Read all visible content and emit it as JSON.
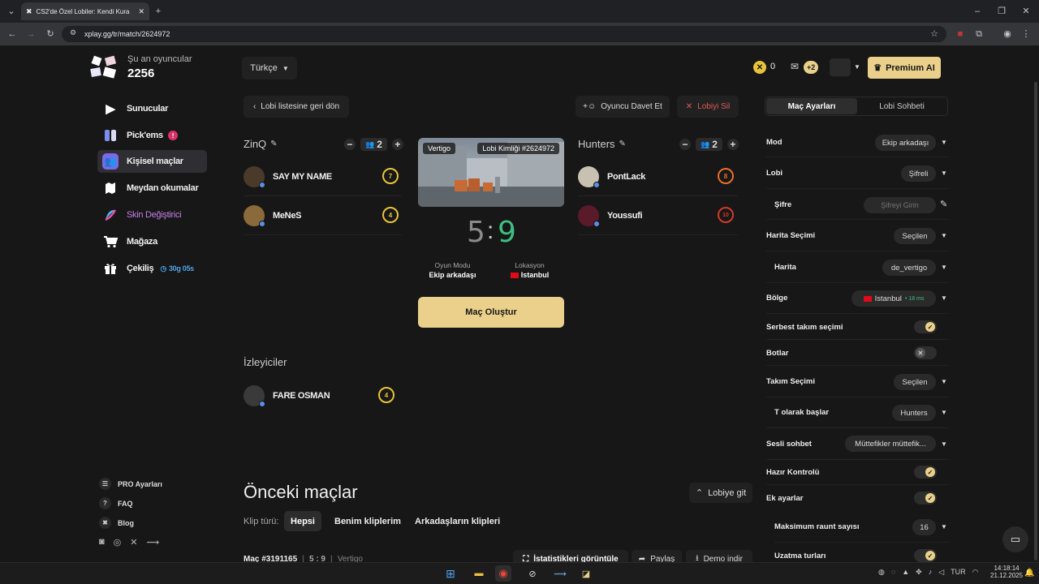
{
  "browser": {
    "tab_title": "CS2'de Özel Lobiler: Kendi Kura",
    "url": "xplay.gg/tr/match/2624972"
  },
  "header": {
    "online_label": "Şu an oyuncular",
    "online_count": "2256",
    "language": "Türkçe",
    "coins": "0",
    "mail_badge": "+2",
    "premium_label": "Premium AI"
  },
  "sidebar": {
    "items": [
      {
        "label": "Sunucular",
        "icon": "play-icon"
      },
      {
        "label": "Pick'ems",
        "icon": "pickems-icon",
        "badge": "!"
      },
      {
        "label": "Kişisel maçlar",
        "icon": "users-icon"
      },
      {
        "label": "Meydan okumalar",
        "icon": "map-icon"
      },
      {
        "label": "Skin Değiştirici",
        "icon": "skin-icon"
      },
      {
        "label": "Mağaza",
        "icon": "cart-icon"
      },
      {
        "label": "Çekiliş",
        "icon": "gift-icon",
        "timer": "30g 05s"
      }
    ],
    "bottom_links": [
      {
        "label": "PRO Ayarları",
        "icon": "list-icon"
      },
      {
        "label": "FAQ",
        "icon": "question-icon"
      },
      {
        "label": "Blog",
        "icon": "blog-icon"
      }
    ]
  },
  "lobby": {
    "back_label": "Lobi listesine geri dön",
    "invite_label": "Oyuncu Davet Et",
    "delete_label": "Lobiyi Sil",
    "team1": {
      "name": "ZinQ",
      "count": "2",
      "players": [
        {
          "name": "SAY MY NAME",
          "level": "7",
          "level_color": "#e8c33a"
        },
        {
          "name": "MeNeS",
          "level": "4",
          "level_color": "#e8c33a"
        }
      ]
    },
    "team2": {
      "name": "Hunters",
      "count": "2",
      "players": [
        {
          "name": "PontLack",
          "level": "8",
          "level_color": "#e8702a"
        },
        {
          "name": "Youssufi",
          "level": "10",
          "level_color": "#d43a2a"
        }
      ]
    },
    "map_tag": "Vertigo",
    "lobby_id": "Lobi Kimliği #2624972",
    "score_left": "5",
    "score_sep": ":",
    "score_right": "9",
    "mode_label": "Oyun Modu",
    "mode_value": "Ekip arkadaşı",
    "location_label": "Lokasyon",
    "location_value": "Istanbul",
    "create_label": "Maç Oluştur",
    "spectators_title": "İzleyiciler",
    "spectators": [
      {
        "name": "FARE OSMAN",
        "level": "4",
        "level_color": "#e8c33a"
      }
    ]
  },
  "previous": {
    "title": "Önceki maçlar",
    "go_lobby": "Lobiye git",
    "clip_label": "Klip türü:",
    "filters": [
      "Hepsi",
      "Benim kliplerim",
      "Arkadaşların klipleri"
    ],
    "match_title": "Maç #3191165",
    "match_score": "5 : 9",
    "match_map": "Vertigo",
    "stats_label": "İstatistikleri görüntüle",
    "share_label": "Paylaş",
    "demo_label": "Demo indir"
  },
  "settings": {
    "tabs": [
      "Maç Ayarları",
      "Lobi Sohbeti"
    ],
    "rows": [
      {
        "label": "Mod",
        "value": "Ekip arkadaşı"
      },
      {
        "label": "Lobi",
        "value": "Şifreli"
      },
      {
        "label": "Şifre",
        "placeholder": "Şifreyi Girin"
      },
      {
        "label": "Harita Seçimi",
        "value": "Seçilen"
      },
      {
        "label": "Harita",
        "value": "de_vertigo"
      },
      {
        "label": "Bölge",
        "value": "Istanbul",
        "ping": "• 18 ms"
      },
      {
        "label": "Serbest takım seçimi",
        "toggle": true
      },
      {
        "label": "Botlar",
        "toggle": false
      },
      {
        "label": "Takım Seçimi",
        "value": "Seçilen"
      },
      {
        "label": "T olarak başlar",
        "value": "Hunters"
      },
      {
        "label": "Sesli sohbet",
        "value": "Müttefikler müttefik..."
      },
      {
        "label": "Hazır Kontrolü",
        "toggle": true
      },
      {
        "label": "Ek ayarlar",
        "toggle": true
      },
      {
        "label": "Maksimum raunt sayısı",
        "value": "16"
      },
      {
        "label": "Uzatma turları",
        "toggle": true
      }
    ]
  },
  "taskbar": {
    "lang": "TUR",
    "time": "14:18:14",
    "date": "21.12.2025"
  }
}
